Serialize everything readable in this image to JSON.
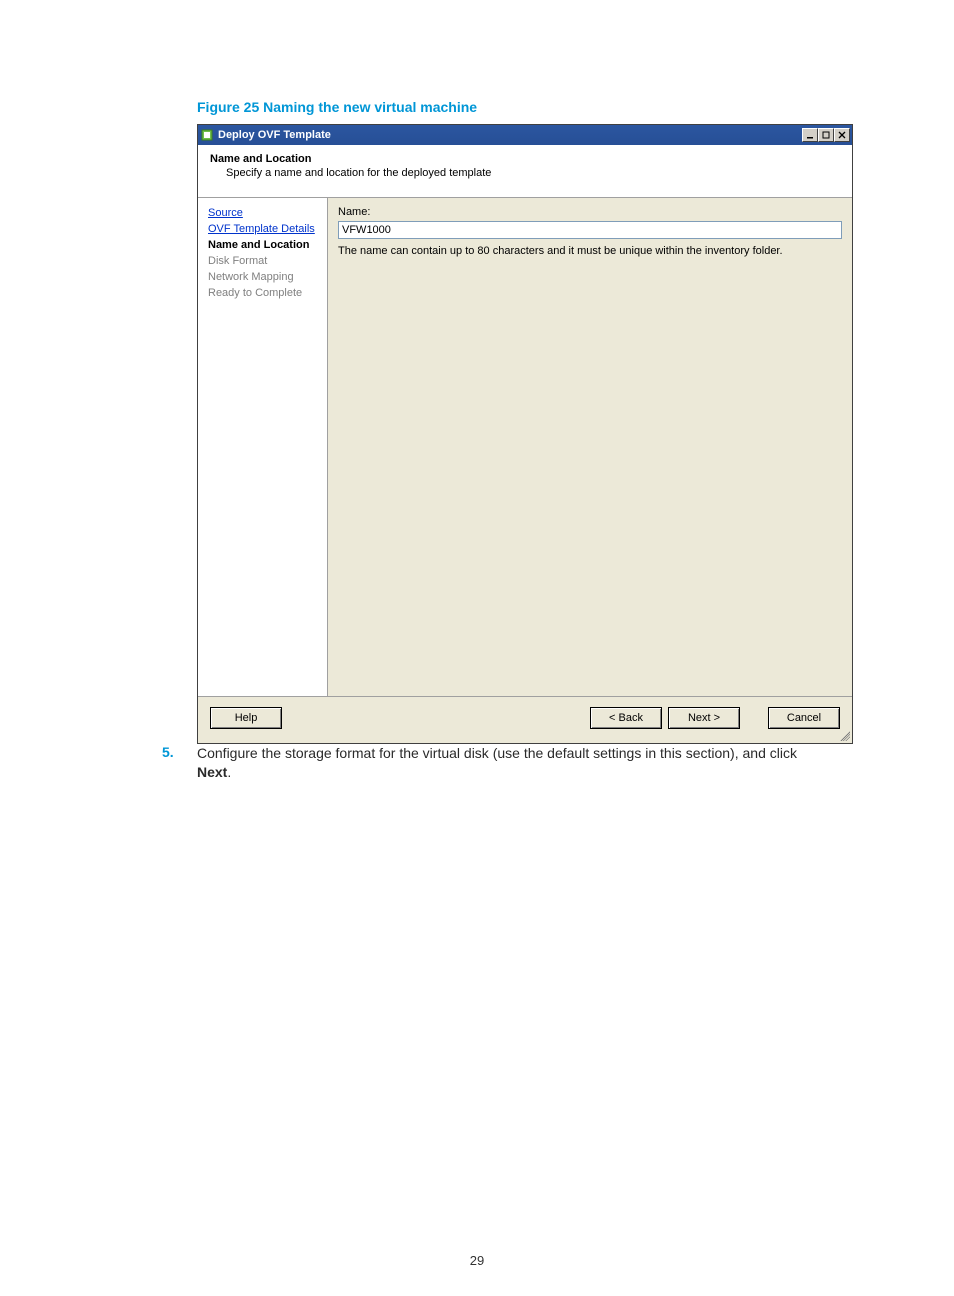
{
  "figure": {
    "caption": "Figure 25 Naming the new virtual machine"
  },
  "window": {
    "title": "Deploy OVF Template",
    "header": {
      "step_name": "Name and Location",
      "step_desc": "Specify a name and location for the deployed template"
    },
    "nav": {
      "source": "Source",
      "details": "OVF Template Details",
      "name_loc": "Name and Location",
      "disk": "Disk Format",
      "network": "Network Mapping",
      "ready": "Ready to Complete"
    },
    "content": {
      "name_label": "Name:",
      "name_value": "VFW1000",
      "helper": "The name can contain up to 80 characters and it must be unique within the inventory folder."
    },
    "buttons": {
      "help": "Help",
      "back": "< Back",
      "next": "Next >",
      "cancel": "Cancel"
    }
  },
  "doc": {
    "step_num": "5.",
    "step_text_a": "Configure the storage format for the virtual disk (use the default settings in this section), and click ",
    "step_bold": "Next",
    "step_text_b": ".",
    "page_num": "29"
  }
}
